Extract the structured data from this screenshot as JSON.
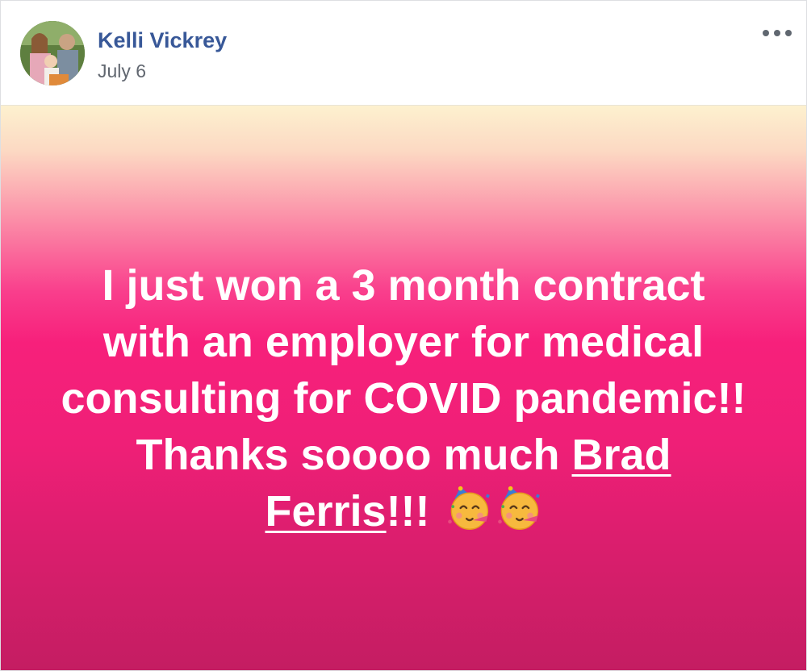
{
  "post": {
    "author": "Kelli Vickrey",
    "date": "July 6",
    "more_icon": "ellipsis-icon",
    "text_before_mention": "I just won a 3 month contract with an employer for medical consulting for COVID pandemic!! Thanks soooo much ",
    "mention": "Brad Ferris",
    "text_after_mention": "!!! ",
    "emojis": [
      "partying-face-emoji",
      "partying-face-emoji"
    ],
    "background_colors": [
      "#fdf1cf",
      "#f7207b",
      "#c41d62"
    ]
  }
}
